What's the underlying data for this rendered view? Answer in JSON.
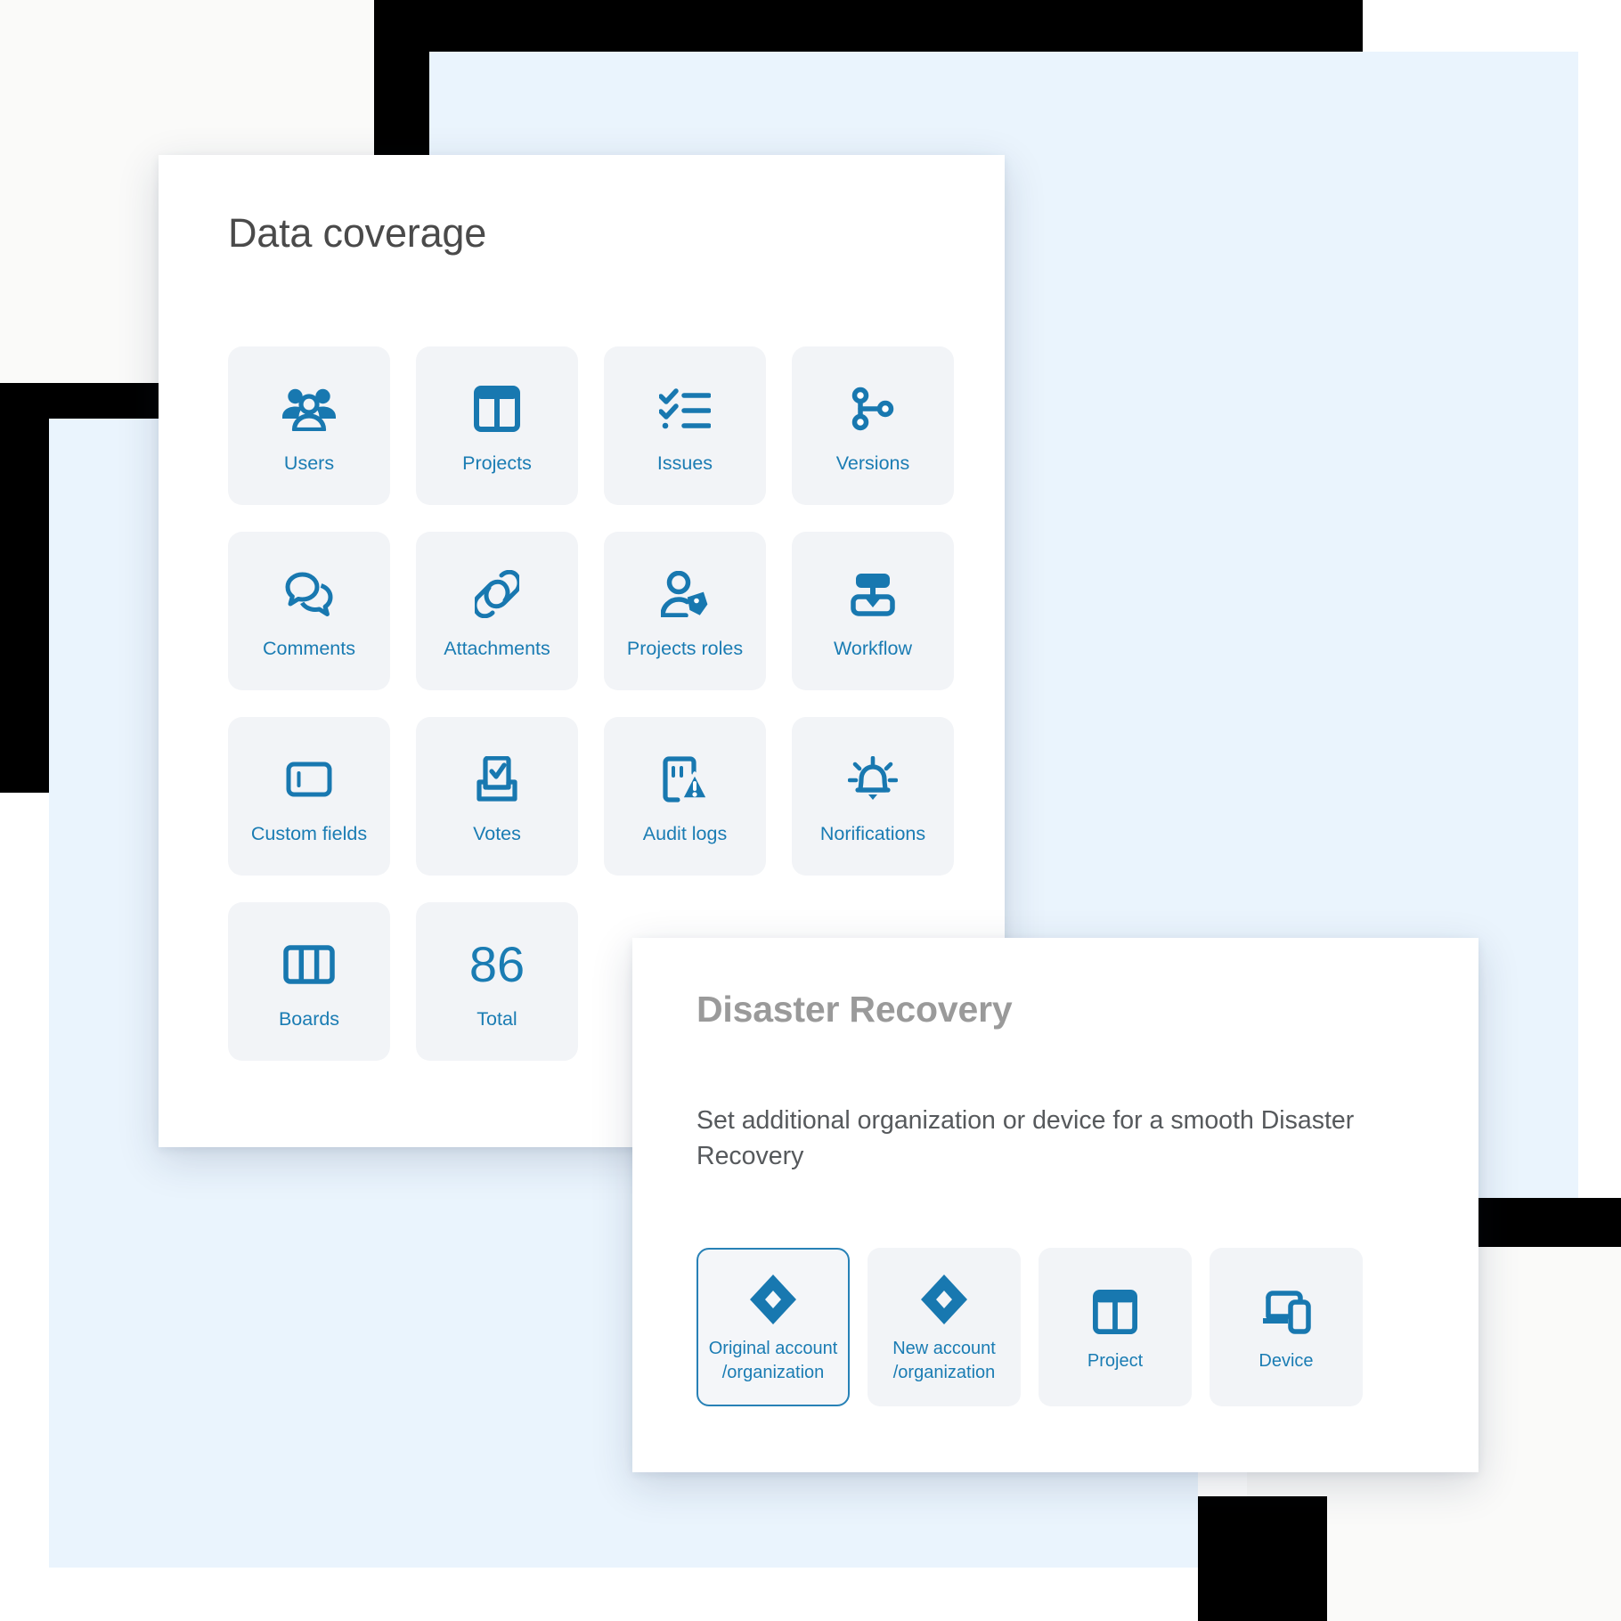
{
  "theme": {
    "accent_blue": "#1a7cb3",
    "icon_blue": "#1878b0",
    "tile_bg": "#f2f4f7",
    "panel_bg": "#ffffff",
    "backdrop_blue": "#eaf4fd",
    "backdrop_black": "#000000",
    "backdrop_offwhite": "#fafaf9",
    "title_gray": "#4a4a4a",
    "dr_title_gray": "#9a9a9a",
    "body_gray": "#56595c"
  },
  "coverage": {
    "title": "Data coverage",
    "tiles": [
      {
        "icon": "users-icon",
        "label": "Users"
      },
      {
        "icon": "projects-icon",
        "label": "Projects"
      },
      {
        "icon": "issues-icon",
        "label": "Issues"
      },
      {
        "icon": "versions-icon",
        "label": "Versions"
      },
      {
        "icon": "comments-icon",
        "label": "Comments"
      },
      {
        "icon": "attachments-icon",
        "label": "Attachments"
      },
      {
        "icon": "project-roles-icon",
        "label": "Projects roles"
      },
      {
        "icon": "workflow-icon",
        "label": "Workflow"
      },
      {
        "icon": "custom-fields-icon",
        "label": "Custom fields"
      },
      {
        "icon": "votes-icon",
        "label": "Votes"
      },
      {
        "icon": "audit-logs-icon",
        "label": "Audit logs"
      },
      {
        "icon": "notifications-icon",
        "label": "Norifications"
      },
      {
        "icon": "boards-icon",
        "label": "Boards"
      }
    ],
    "total_tile": {
      "value": "86",
      "label": "Total"
    }
  },
  "disaster_recovery": {
    "title": "Disaster Recovery",
    "subtitle": "Set additional organization or device for a smooth Disaster Recovery",
    "options": [
      {
        "icon": "jira-diamond-icon",
        "label": "Original account /organization",
        "line1": "Original account",
        "line2": "/organization",
        "selected": true
      },
      {
        "icon": "jira-diamond-icon",
        "label": "New account /organization",
        "line1": "New account",
        "line2": "/organization",
        "selected": false
      },
      {
        "icon": "projects-icon",
        "label": "Project",
        "line1": "Project",
        "line2": "",
        "selected": false
      },
      {
        "icon": "device-icon",
        "label": "Device",
        "line1": "Device",
        "line2": "",
        "selected": false
      }
    ]
  }
}
